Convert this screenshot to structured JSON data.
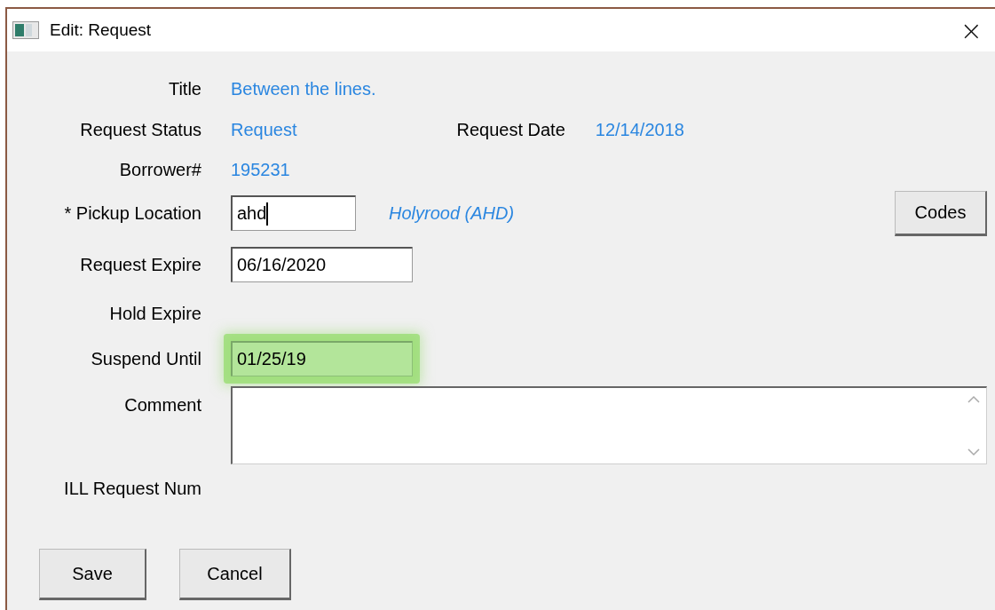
{
  "window": {
    "title": "Edit: Request",
    "close": "×"
  },
  "rows": [
    {
      "kind": "text",
      "label": "Title",
      "value": "Between the lines."
    },
    {
      "kind": "text",
      "label": "Request Status",
      "value": "Request",
      "extra_label": "Request Date",
      "extra_value": "12/14/2018"
    },
    {
      "kind": "text",
      "label": "Borrower#",
      "value": "195231"
    },
    {
      "kind": "input",
      "label": "* Pickup Location",
      "value": "ahd",
      "focused": true,
      "hint": "Holyrood (AHD)",
      "button": "Codes"
    },
    {
      "kind": "input",
      "label": "Request Expire",
      "value": "06/16/2020"
    },
    {
      "kind": "empty",
      "label": "Hold Expire"
    },
    {
      "kind": "input",
      "label": "Suspend Until",
      "value": "01/25/19",
      "highlighted": true
    },
    {
      "kind": "textarea",
      "label": "Comment"
    },
    {
      "kind": "empty",
      "label": "ILL Request Num"
    }
  ],
  "buttons": [
    "Save",
    "Cancel"
  ]
}
